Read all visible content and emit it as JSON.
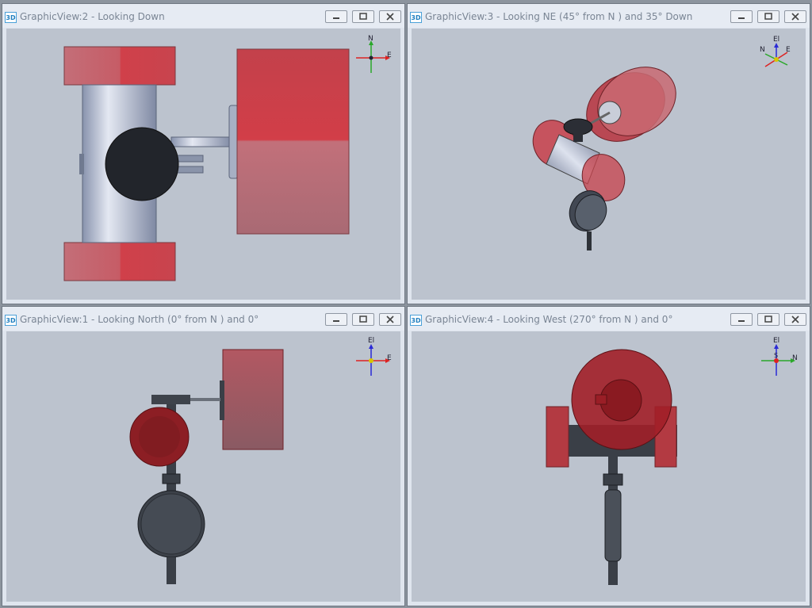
{
  "windows": [
    {
      "title": "GraphicView:2 - Looking Down",
      "icon": "3D",
      "triad": {
        "up": "N",
        "right": "E"
      }
    },
    {
      "title": "GraphicView:3 - Looking NE (45° from N ) and 35° Down",
      "icon": "3D",
      "triad": {
        "up": "El",
        "left": "N",
        "right": "E"
      }
    },
    {
      "title": "GraphicView:1 - Looking North (0° from N ) and 0°",
      "icon": "3D",
      "triad": {
        "up": "El",
        "right": "E"
      }
    },
    {
      "title": "GraphicView:4 - Looking West (270° from N ) and 0°",
      "icon": "3D",
      "triad": {
        "up": "El",
        "center": "S",
        "right": "N"
      }
    }
  ],
  "controls": {
    "minimize": "minimize-icon",
    "maximize": "maximize-icon",
    "close": "close-icon"
  },
  "colors": {
    "viewport_bg": "#bcc3ce",
    "flange_red": "#c8474f",
    "pipe_steel": "#b8c0d0",
    "dark_part": "#2a2d33"
  }
}
